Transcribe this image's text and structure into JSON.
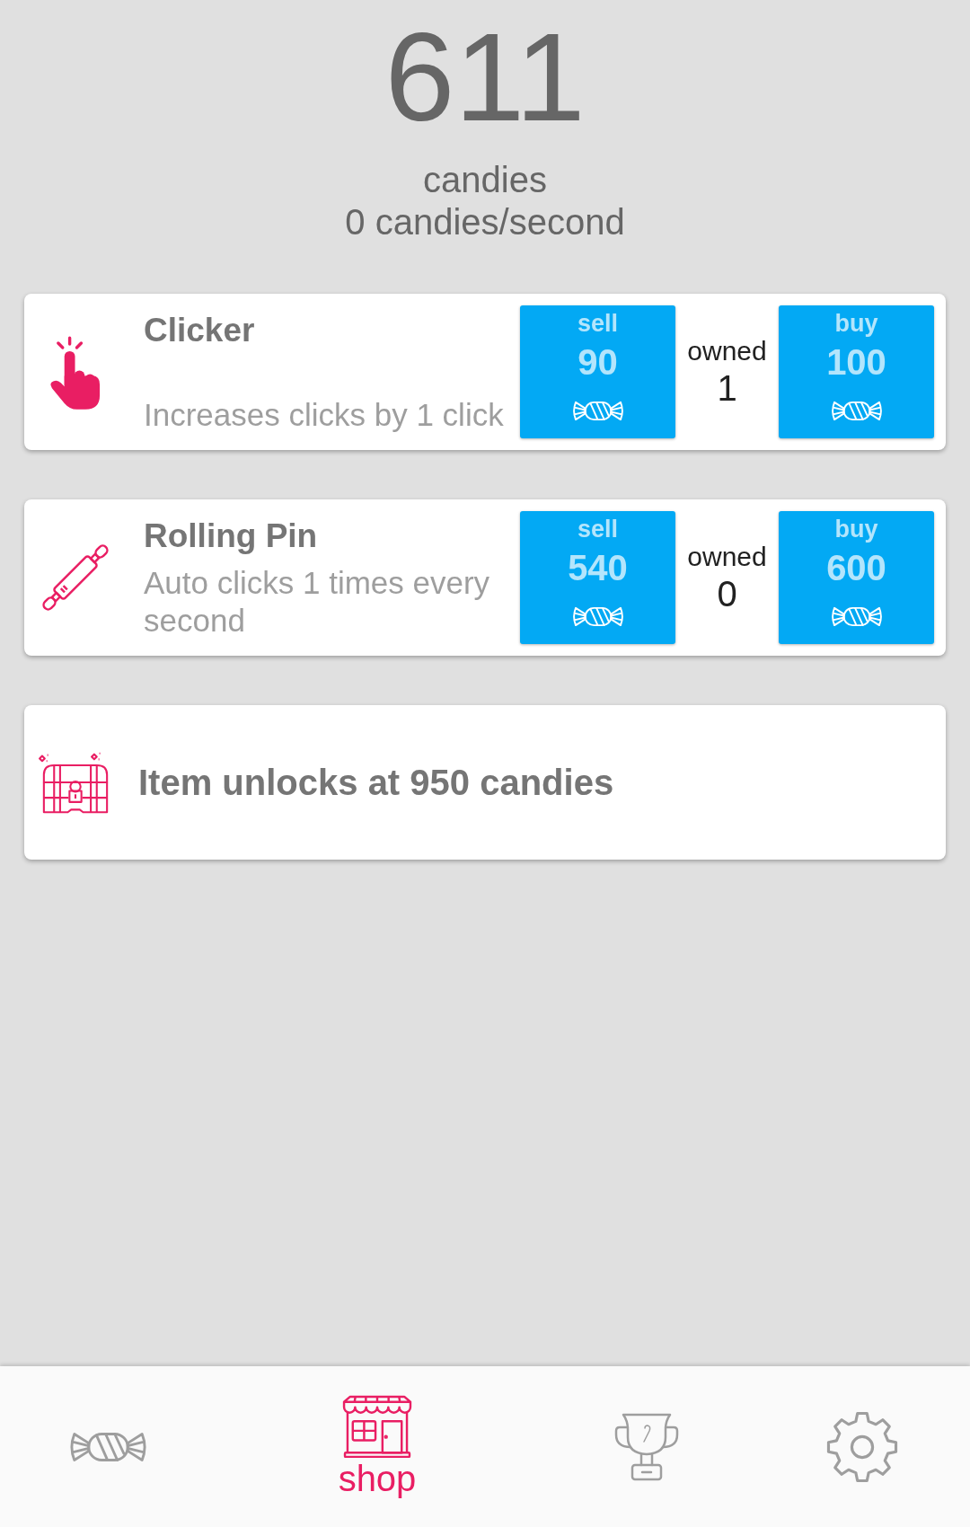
{
  "counter": {
    "value": "611",
    "unit": "candies",
    "rate": "0 candies/second"
  },
  "items": [
    {
      "kind": "item",
      "name": "Clicker",
      "description": "Increases clicks by 1 click",
      "sell_label": "sell",
      "sell_price": "90",
      "owned_label": "owned",
      "owned": "1",
      "buy_label": "buy",
      "buy_price": "100"
    },
    {
      "kind": "item",
      "name": "Rolling Pin",
      "description": "Auto clicks 1 times every second",
      "sell_label": "sell",
      "sell_price": "540",
      "owned_label": "owned",
      "owned": "0",
      "buy_label": "buy",
      "buy_price": "600"
    },
    {
      "kind": "locked",
      "message": "Item unlocks at 950 candies"
    }
  ],
  "nav": [
    {
      "selected": false
    },
    {
      "label": "shop",
      "selected": true
    },
    {
      "selected": false
    },
    {
      "selected": false
    }
  ]
}
